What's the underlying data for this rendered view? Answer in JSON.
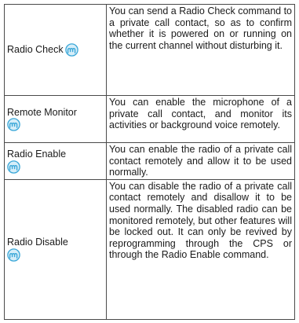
{
  "features": [
    {
      "name": "Radio Check",
      "icon": "radio-wave-icon",
      "description": "You can send a Radio Check command to a private call contact, so as to confirm whether it is powered on or running on the current channel without disturbing it."
    },
    {
      "name": "Remote Monitor",
      "icon": "radio-wave-icon",
      "description": "You can enable the microphone of a private call contact, and monitor its activities or background voice remotely."
    },
    {
      "name": "Radio Enable",
      "icon": "radio-wave-icon",
      "description": "You can enable the radio of a private call contact remotely and allow it to be used normally."
    },
    {
      "name": "Radio Disable",
      "icon": "radio-wave-icon",
      "description": "You can disable the radio of a private call contact remotely and disallow it to be used normally. The disabled radio can be monitored remotely, but other features will be locked out. It can only be revived by reprogramming through the CPS or through the Radio Enable command."
    }
  ],
  "colors": {
    "icon": "#3aa7d8",
    "border": "#4a4a4a"
  }
}
